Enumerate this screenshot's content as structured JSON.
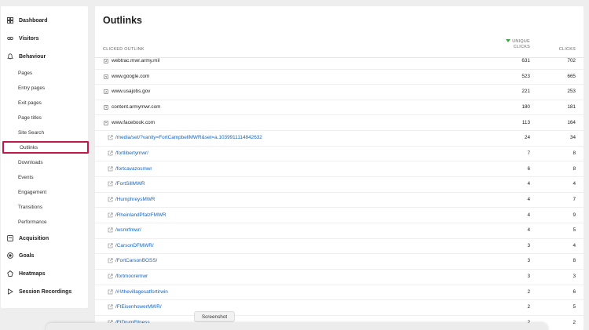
{
  "sidebar": {
    "groups": [
      {
        "label": "Dashboard",
        "icon": "dashboard-icon"
      },
      {
        "label": "Visitors",
        "icon": "visitors-icon"
      },
      {
        "label": "Behaviour",
        "icon": "behaviour-icon"
      },
      {
        "label": "Acquisition",
        "icon": "acquisition-icon"
      },
      {
        "label": "Goals",
        "icon": "goals-icon"
      },
      {
        "label": "Heatmaps",
        "icon": "heatmaps-icon"
      },
      {
        "label": "Session Recordings",
        "icon": "session-recordings-icon"
      }
    ],
    "behaviour_items": [
      "Pages",
      "Entry pages",
      "Exit pages",
      "Page titles",
      "Site Search",
      "Outlinks",
      "Downloads",
      "Events",
      "Engagement",
      "Transitions",
      "Performance"
    ],
    "active_item": "Outlinks",
    "active_color": "#c0184a"
  },
  "main": {
    "title": "Outlinks",
    "columns": {
      "outlink": "CLICKED OUTLINK",
      "unique_line1": "UNIQUE",
      "unique_line2": "CLICKS",
      "clicks": "CLICKS"
    },
    "rows": [
      {
        "label": "webtrac.mwr.army.mil",
        "unique": "631",
        "clicks": "702",
        "kind": "parent",
        "expanded": false
      },
      {
        "label": "www.google.com",
        "unique": "523",
        "clicks": "665",
        "kind": "parent",
        "expanded": false
      },
      {
        "label": "www.usajobs.gov",
        "unique": "221",
        "clicks": "253",
        "kind": "parent",
        "expanded": false
      },
      {
        "label": "content.armymwr.com",
        "unique": "180",
        "clicks": "181",
        "kind": "parent",
        "expanded": false
      },
      {
        "label": "www.facebook.com",
        "unique": "113",
        "clicks": "164",
        "kind": "parent",
        "expanded": true
      },
      {
        "label": "/media/set/?vanity=FortCampbellMWR&set=a.1039911114842632",
        "unique": "24",
        "clicks": "34",
        "kind": "child"
      },
      {
        "label": "/fortlibertymwr/",
        "unique": "7",
        "clicks": "8",
        "kind": "child"
      },
      {
        "label": "/fortcavazosmwr",
        "unique": "6",
        "clicks": "8",
        "kind": "child"
      },
      {
        "label": "/FortSillMWR",
        "unique": "4",
        "clicks": "4",
        "kind": "child"
      },
      {
        "label": "/HumphreysMWR",
        "unique": "4",
        "clicks": "7",
        "kind": "child"
      },
      {
        "label": "/RheinlandPfalzFMWR",
        "unique": "4",
        "clicks": "9",
        "kind": "child"
      },
      {
        "label": "/wsmrfmwr/",
        "unique": "4",
        "clicks": "5",
        "kind": "child"
      },
      {
        "label": "/CarsonDFMWR/",
        "unique": "3",
        "clicks": "4",
        "kind": "child"
      },
      {
        "label": "/FortCarsonBOSS/",
        "unique": "3",
        "clicks": "8",
        "kind": "child"
      },
      {
        "label": "/fortmooremwr",
        "unique": "3",
        "clicks": "3",
        "kind": "child"
      },
      {
        "label": "/#!/thevillagesatfortirwin",
        "unique": "2",
        "clicks": "6",
        "kind": "child"
      },
      {
        "label": "/FtEisenhowerMWR/",
        "unique": "2",
        "clicks": "5",
        "kind": "child"
      },
      {
        "label": "/FtDrumFitness",
        "unique": "2",
        "clicks": "2",
        "kind": "child"
      }
    ]
  },
  "overlay": {
    "tooltip": "Screenshot"
  },
  "colors": {
    "link": "#1565c0",
    "sort_indicator": "#43a047",
    "background": "#eeeeee"
  }
}
